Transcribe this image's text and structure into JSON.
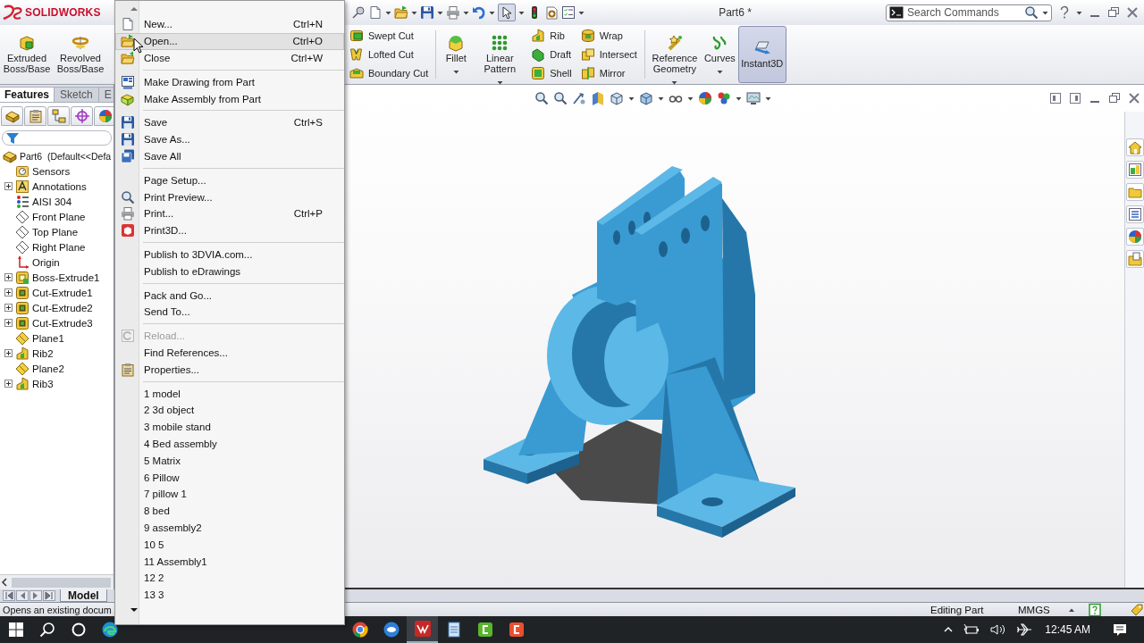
{
  "app": {
    "logo": "SOLIDWORKS",
    "title": "Part6 *"
  },
  "search": {
    "placeholder": "Search Commands"
  },
  "ribbon": {
    "groups": [
      [
        {
          "kind": "large",
          "label": "Extruded Boss/Base",
          "dropdown": false,
          "active": false
        },
        {
          "kind": "large",
          "label": "Revolved Boss/Base",
          "dropdown": false,
          "active": false
        }
      ],
      [
        {
          "kind": "stack",
          "items": [
            "Swept Cut",
            "Lofted Cut",
            "Boundary Cut"
          ]
        }
      ],
      [
        {
          "kind": "large",
          "label": "Fillet",
          "dropdown": true,
          "active": false
        },
        {
          "kind": "large",
          "label": "Linear Pattern",
          "dropdown": true,
          "active": false
        },
        {
          "kind": "stack",
          "items": [
            "Rib",
            "Draft",
            "Shell"
          ]
        },
        {
          "kind": "stack",
          "items": [
            "Wrap",
            "Intersect",
            "Mirror"
          ]
        }
      ],
      [
        {
          "kind": "large",
          "label": "Reference Geometry",
          "dropdown": true,
          "active": false
        },
        {
          "kind": "large",
          "label": "Curves",
          "dropdown": true,
          "active": false
        },
        {
          "kind": "large",
          "label": "Instant3D",
          "dropdown": false,
          "active": true
        }
      ]
    ]
  },
  "feature_manager": {
    "tabs": [
      {
        "label": "Features",
        "selected": true
      },
      {
        "label": "Sketch",
        "selected": false
      },
      {
        "label": "E",
        "selected": false
      }
    ],
    "tree": {
      "label": "Part6  (Default<<Defa",
      "children": [
        {
          "label": "Sensors",
          "expandable": false
        },
        {
          "label": "Annotations",
          "expandable": true
        },
        {
          "label": "AISI 304",
          "expandable": false
        },
        {
          "label": "Front Plane",
          "expandable": false
        },
        {
          "label": "Top Plane",
          "expandable": false
        },
        {
          "label": "Right Plane",
          "expandable": false
        },
        {
          "label": "Origin",
          "expandable": false
        },
        {
          "label": "Boss-Extrude1",
          "expandable": true
        },
        {
          "label": "Cut-Extrude1",
          "expandable": true
        },
        {
          "label": "Cut-Extrude2",
          "expandable": true
        },
        {
          "label": "Cut-Extrude3",
          "expandable": true
        },
        {
          "label": "Plane1",
          "expandable": false
        },
        {
          "label": "Rib2",
          "expandable": true
        },
        {
          "label": "Plane2",
          "expandable": false
        },
        {
          "label": "Rib3",
          "expandable": true
        }
      ]
    }
  },
  "model_tabs": [
    {
      "label": "Model",
      "selected": true
    }
  ],
  "status_bar": {
    "message": "Opens an existing docum",
    "mode": "Editing Part",
    "units": "MMGS"
  },
  "file_menu": {
    "items": [
      {
        "kind": "item",
        "label": "New...",
        "shortcut": "Ctrl+N",
        "selected": false,
        "disabled": false
      },
      {
        "kind": "item",
        "label": "Open...",
        "shortcut": "Ctrl+O",
        "selected": true,
        "disabled": false
      },
      {
        "kind": "item",
        "label": "Close",
        "shortcut": "Ctrl+W",
        "selected": false,
        "disabled": false
      },
      {
        "kind": "separator"
      },
      {
        "kind": "item",
        "label": "Make Drawing from Part",
        "selected": false,
        "disabled": false
      },
      {
        "kind": "item",
        "label": "Make Assembly from Part",
        "selected": false,
        "disabled": false
      },
      {
        "kind": "separator"
      },
      {
        "kind": "item",
        "label": "Save",
        "shortcut": "Ctrl+S",
        "selected": false,
        "disabled": false
      },
      {
        "kind": "item",
        "label": "Save As...",
        "selected": false,
        "disabled": false
      },
      {
        "kind": "item",
        "label": "Save All",
        "selected": false,
        "disabled": false
      },
      {
        "kind": "separator"
      },
      {
        "kind": "item",
        "label": "Page Setup...",
        "selected": false,
        "disabled": false
      },
      {
        "kind": "item",
        "label": "Print Preview...",
        "selected": false,
        "disabled": false
      },
      {
        "kind": "item",
        "label": "Print...",
        "shortcut": "Ctrl+P",
        "selected": false,
        "disabled": false
      },
      {
        "kind": "item",
        "label": "Print3D...",
        "selected": false,
        "disabled": false
      },
      {
        "kind": "separator"
      },
      {
        "kind": "item",
        "label": "Publish to 3DVIA.com...",
        "selected": false,
        "disabled": false
      },
      {
        "kind": "item",
        "label": "Publish to eDrawings",
        "selected": false,
        "disabled": false
      },
      {
        "kind": "separator"
      },
      {
        "kind": "item",
        "label": "Pack and Go...",
        "selected": false,
        "disabled": false
      },
      {
        "kind": "item",
        "label": "Send To...",
        "selected": false,
        "disabled": false
      },
      {
        "kind": "separator"
      },
      {
        "kind": "item",
        "label": "Reload...",
        "selected": false,
        "disabled": true
      },
      {
        "kind": "item",
        "label": "Find References...",
        "selected": false,
        "disabled": false
      },
      {
        "kind": "item",
        "label": "Properties...",
        "selected": false,
        "disabled": false
      },
      {
        "kind": "separator"
      },
      {
        "kind": "item",
        "label": "1 model",
        "selected": false,
        "disabled": false
      },
      {
        "kind": "item",
        "label": "2 3d object",
        "selected": false,
        "disabled": false
      },
      {
        "kind": "item",
        "label": "3 mobile stand",
        "selected": false,
        "disabled": false
      },
      {
        "kind": "item",
        "label": "4 Bed assembly",
        "selected": false,
        "disabled": false
      },
      {
        "kind": "item",
        "label": "5 Matrix",
        "selected": false,
        "disabled": false
      },
      {
        "kind": "item",
        "label": "6 Pillow",
        "selected": false,
        "disabled": false
      },
      {
        "kind": "item",
        "label": "7 pillow 1",
        "selected": false,
        "disabled": false
      },
      {
        "kind": "item",
        "label": "8 bed",
        "selected": false,
        "disabled": false
      },
      {
        "kind": "item",
        "label": "9 assembly2",
        "selected": false,
        "disabled": false
      },
      {
        "kind": "item",
        "label": "10 5",
        "selected": false,
        "disabled": false
      },
      {
        "kind": "item",
        "label": "11 Assembly1",
        "selected": false,
        "disabled": false
      },
      {
        "kind": "item",
        "label": "12 2",
        "selected": false,
        "disabled": false
      },
      {
        "kind": "item",
        "label": "13 3",
        "selected": false,
        "disabled": false
      }
    ]
  },
  "taskbar": {
    "apps": [
      {
        "selected": false
      },
      {
        "selected": false
      },
      {
        "selected": false
      },
      {
        "selected": true
      },
      {
        "selected": false
      },
      {
        "selected": false
      },
      {
        "selected": false
      }
    ],
    "clock": "12:45 AM"
  }
}
